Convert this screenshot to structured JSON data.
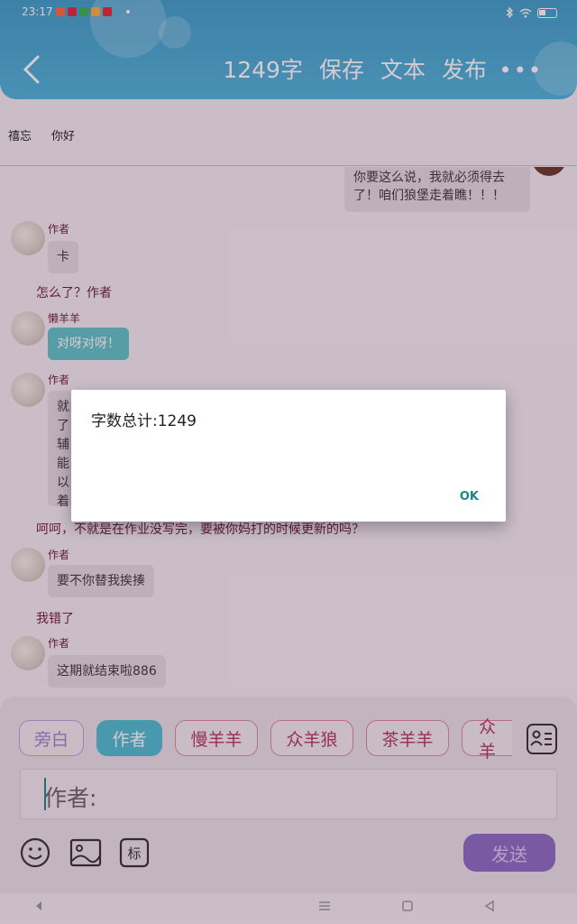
{
  "status": {
    "time": "23:17"
  },
  "header": {
    "word_count": "1249字",
    "save": "保存",
    "text": "文本",
    "publish": "发布",
    "more": "•••"
  },
  "tags": [
    "禧忘",
    "你好"
  ],
  "chat": {
    "top_bubble": "你要这么说，我就必须得去了！咱们狼堡走着瞧！！！",
    "m1_name": "作者",
    "m1_text": "卡",
    "n1": "怎么了？作者",
    "m2_name": "懒羊羊",
    "m2_text": "对呀对呀！",
    "m3_name": "作者",
    "m3_text": "就了辅能以着",
    "n2": "呵呵，不就是在作业没写完，要被你妈打的时候更新的吗？",
    "m4_name": "作者",
    "m4_text": "要不你替我挨揍",
    "n3": "我错了",
    "m5_name": "作者",
    "m5_text": "这期就结束啦886"
  },
  "dialog": {
    "message": "字数总计:1249",
    "ok": "OK"
  },
  "composer": {
    "roles": [
      "旁白",
      "作者",
      "慢羊羊",
      "众羊狼",
      "茶羊羊",
      "众羊"
    ],
    "input_value": "作者:",
    "send": "发送"
  },
  "colors": {
    "header": "#3fa0c9",
    "accent": "#4dbfd1",
    "send": "#8b6fc2",
    "dialog_ok": "#178a87"
  }
}
